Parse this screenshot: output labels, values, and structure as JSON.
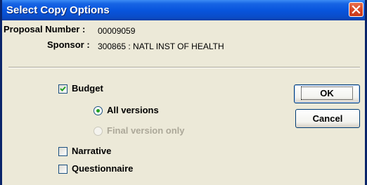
{
  "window": {
    "title": "Select Copy Options"
  },
  "header": {
    "proposal_label": "Proposal Number :",
    "proposal_value": "00009059",
    "sponsor_label": "Sponsor :",
    "sponsor_value": "300865 : NATL INST OF HEALTH"
  },
  "options": {
    "budget": {
      "label": "Budget",
      "checked": true
    },
    "budget_versions": [
      {
        "label": "All versions",
        "selected": true,
        "enabled": true
      },
      {
        "label": "Final version only",
        "selected": false,
        "enabled": false
      }
    ],
    "narrative": {
      "label": "Narrative",
      "checked": false
    },
    "questionnaire": {
      "label": "Questionnaire",
      "checked": false
    }
  },
  "buttons": {
    "ok_label": "OK",
    "cancel_label": "Cancel"
  },
  "colors": {
    "titlebar": "#0855DD",
    "dialog_bg": "#ECE9D8",
    "close_button": "#DA4A27",
    "check_mark": "#21A121",
    "disabled_text": "#ACA899"
  }
}
